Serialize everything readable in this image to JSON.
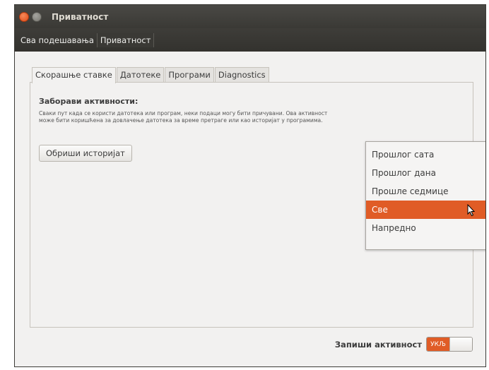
{
  "window": {
    "title": "Приватност"
  },
  "toolbar": {
    "all_settings": "Сва подешавања",
    "current": "Приватност"
  },
  "tabs": [
    {
      "label": "Скорашње ставке"
    },
    {
      "label": "Датотеке"
    },
    {
      "label": "Програми"
    },
    {
      "label": "Diagnostics"
    }
  ],
  "panel": {
    "title": "Заборави активности:",
    "description": "Сваки пут када се користи датотека или програм, неки подаци могу бити причувани. Ова активност може бити коришћена за довлачење датотека за време претраге или као историјат у програмима.",
    "clear_button": "Обриши историјат"
  },
  "dropdown": {
    "items": [
      {
        "label": "Прошлог сата"
      },
      {
        "label": "Прошлог дана"
      },
      {
        "label": "Прошле седмице"
      },
      {
        "label": "Све"
      },
      {
        "label": "Напредно"
      }
    ],
    "highlighted": "Све"
  },
  "footer": {
    "record_label": "Запиши активност",
    "toggle_state": "УКЉ"
  },
  "colors": {
    "accent": "#e05c26",
    "titlebar": "#3c3b37"
  }
}
